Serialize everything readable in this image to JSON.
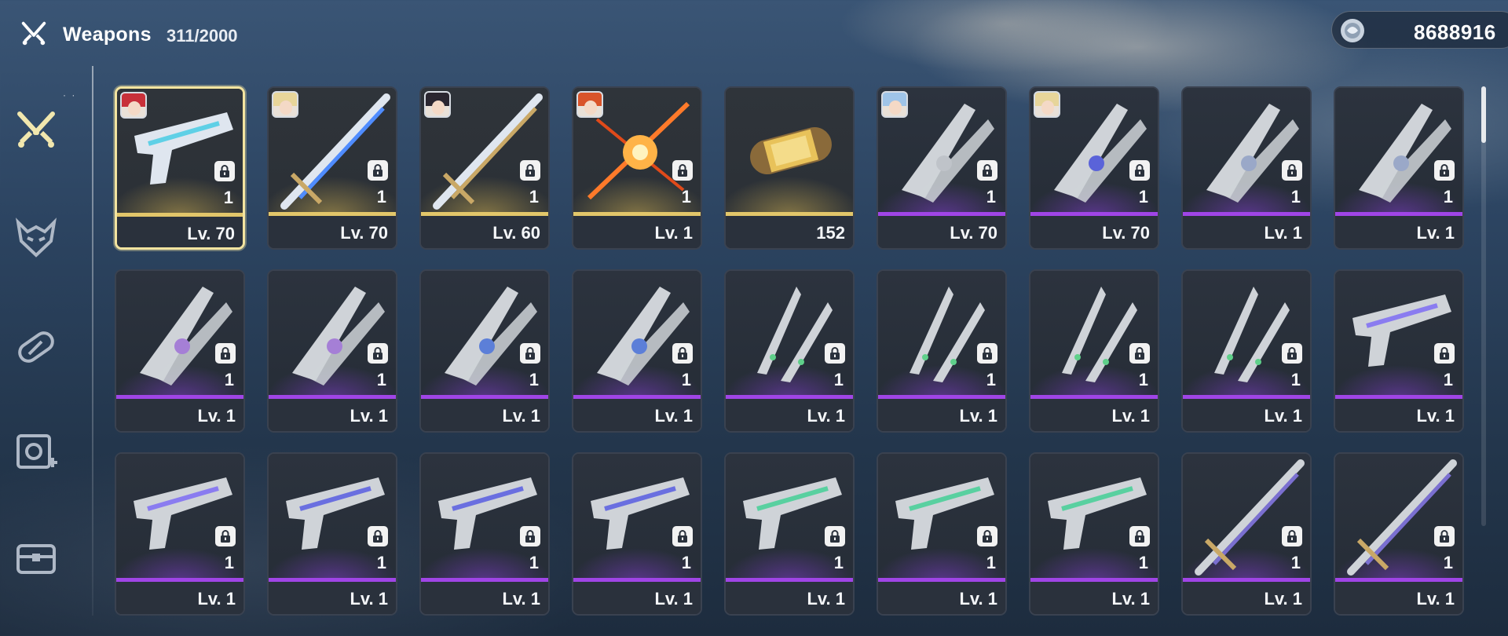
{
  "header": {
    "title": "Weapons",
    "count": "311/2000",
    "title_icon": "crossed-swords-icon",
    "currency": {
      "icon": "shell-credit-icon",
      "value": "8688916"
    }
  },
  "sidebar": {
    "items": [
      {
        "name": "weapons",
        "icon": "crossed-swords-icon",
        "active": true
      },
      {
        "name": "echoes",
        "icon": "demon-mask-icon",
        "active": false
      },
      {
        "name": "upgrade-materials",
        "icon": "capsule-icon",
        "active": false
      },
      {
        "name": "development-items",
        "icon": "tuner-icon",
        "active": false
      },
      {
        "name": "supplies",
        "icon": "chest-icon",
        "active": false
      }
    ]
  },
  "colors": {
    "gold": "#e2c66a",
    "purple": "#a045e6",
    "selected_border": "#f3e4a0"
  },
  "cards": [
    {
      "rarity": "gold",
      "weapon": "pistol-icon",
      "avatar": "red-hair-avatar",
      "qty": "1",
      "level": "Lv. 70",
      "locked": true,
      "selected": true
    },
    {
      "rarity": "gold",
      "weapon": "sword-icon",
      "avatar": "blonde-avatar",
      "qty": "1",
      "level": "Lv. 70",
      "locked": true
    },
    {
      "rarity": "gold",
      "weapon": "broadsword-icon",
      "avatar": "dark-hair-avatar",
      "qty": "1",
      "level": "Lv. 60",
      "locked": true
    },
    {
      "rarity": "gold",
      "weapon": "flame-rectifier-icon",
      "avatar": "orange-hair-avatar",
      "qty": "1",
      "level": "Lv. 1",
      "locked": true
    },
    {
      "rarity": "gold",
      "weapon": "capsule-icon",
      "qty": "",
      "level": "152",
      "locked": false
    },
    {
      "rarity": "purple",
      "weapon": "gauntlet-icon",
      "avatar": "blue-hair-avatar",
      "qty": "1",
      "level": "Lv. 70",
      "locked": true
    },
    {
      "rarity": "purple",
      "weapon": "dark-rectifier-icon",
      "avatar": "blonde-avatar",
      "qty": "1",
      "level": "Lv. 70",
      "locked": true
    },
    {
      "rarity": "purple",
      "weapon": "winged-rectifier-icon",
      "qty": "1",
      "level": "Lv. 1",
      "locked": true
    },
    {
      "rarity": "purple",
      "weapon": "winged-rectifier-icon",
      "qty": "1",
      "level": "Lv. 1",
      "locked": true
    },
    {
      "rarity": "purple",
      "weapon": "claw-gauntlet-icon",
      "qty": "1",
      "level": "Lv. 1",
      "locked": true
    },
    {
      "rarity": "purple",
      "weapon": "claw-gauntlet-icon",
      "qty": "1",
      "level": "Lv. 1",
      "locked": true
    },
    {
      "rarity": "purple",
      "weapon": "blue-gauntlet-icon",
      "qty": "1",
      "level": "Lv. 1",
      "locked": true
    },
    {
      "rarity": "purple",
      "weapon": "blue-gauntlet-icon",
      "qty": "1",
      "level": "Lv. 1",
      "locked": true
    },
    {
      "rarity": "purple",
      "weapon": "twin-blade-icon",
      "qty": "1",
      "level": "Lv. 1",
      "locked": true
    },
    {
      "rarity": "purple",
      "weapon": "twin-blade-icon",
      "qty": "1",
      "level": "Lv. 1",
      "locked": true
    },
    {
      "rarity": "purple",
      "weapon": "twin-blade-icon",
      "qty": "1",
      "level": "Lv. 1",
      "locked": true
    },
    {
      "rarity": "purple",
      "weapon": "twin-blade-icon",
      "qty": "1",
      "level": "Lv. 1",
      "locked": true
    },
    {
      "rarity": "purple",
      "weapon": "blade-pistol-icon",
      "qty": "1",
      "level": "Lv. 1",
      "locked": true
    },
    {
      "rarity": "purple",
      "weapon": "blade-pistol-icon",
      "qty": "1",
      "level": "Lv. 1",
      "locked": true
    },
    {
      "rarity": "purple",
      "weapon": "blue-pistol-icon",
      "qty": "1",
      "level": "Lv. 1",
      "locked": true
    },
    {
      "rarity": "purple",
      "weapon": "blue-pistol-icon",
      "qty": "1",
      "level": "Lv. 1",
      "locked": true
    },
    {
      "rarity": "purple",
      "weapon": "blue-pistol-icon",
      "qty": "1",
      "level": "Lv. 1",
      "locked": true
    },
    {
      "rarity": "purple",
      "weapon": "white-pistol-icon",
      "qty": "1",
      "level": "Lv. 1",
      "locked": true
    },
    {
      "rarity": "purple",
      "weapon": "white-pistol-icon",
      "qty": "1",
      "level": "Lv. 1",
      "locked": true
    },
    {
      "rarity": "purple",
      "weapon": "white-pistol-icon",
      "qty": "1",
      "level": "Lv. 1",
      "locked": true
    },
    {
      "rarity": "purple",
      "weapon": "long-blade-icon",
      "qty": "1",
      "level": "Lv. 1",
      "locked": true
    },
    {
      "rarity": "purple",
      "weapon": "long-blade-icon",
      "qty": "1",
      "level": "Lv. 1",
      "locked": true
    }
  ]
}
